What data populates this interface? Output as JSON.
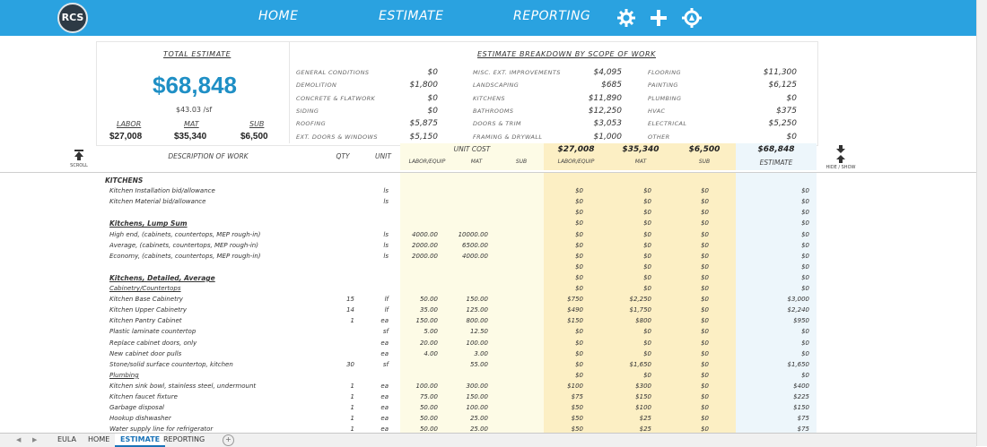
{
  "nav": {
    "logo": "RCS",
    "home": "HOME",
    "estimate": "ESTIMATE",
    "reporting": "REPORTING",
    "icons": [
      "gear-icon",
      "plus-icon",
      "settings-icon"
    ]
  },
  "summary": {
    "total_estimate_label": "TOTAL ESTIMATE",
    "total": "$68,848",
    "per_sf": "$43.03 /sf",
    "labor_label": "LABOR",
    "mat_label": "MAT",
    "sub_label": "SUB",
    "labor": "$27,008",
    "mat": "$35,340",
    "sub": "$6,500"
  },
  "breakdown": {
    "title": "ESTIMATE BREAKDOWN BY SCOPE OF WORK",
    "col1": [
      {
        "label": "GENERAL CONDITIONS",
        "value": "$0"
      },
      {
        "label": "DEMOLITION",
        "value": "$1,800"
      },
      {
        "label": "CONCRETE & FLATWORK",
        "value": "$0"
      },
      {
        "label": "SIDING",
        "value": "$0"
      },
      {
        "label": "ROOFING",
        "value": "$5,875"
      },
      {
        "label": "EXT. DOORS & WINDOWS",
        "value": "$5,150"
      }
    ],
    "col2": [
      {
        "label": "MISC. EXT. IMPROVEMENTS",
        "value": "$4,095"
      },
      {
        "label": "LANDSCAPING",
        "value": "$685"
      },
      {
        "label": "KITCHENS",
        "value": "$11,890"
      },
      {
        "label": "BATHROOMS",
        "value": "$12,250"
      },
      {
        "label": "DOORS & TRIM",
        "value": "$3,053"
      },
      {
        "label": "FRAMING & DRYWALL",
        "value": "$1,000"
      }
    ],
    "col3": [
      {
        "label": "FLOORING",
        "value": "$11,300"
      },
      {
        "label": "PAINTING",
        "value": "$6,125"
      },
      {
        "label": "PLUMBING",
        "value": "$0"
      },
      {
        "label": "HVAC",
        "value": "$375"
      },
      {
        "label": "ELECTRICAL",
        "value": "$5,250"
      },
      {
        "label": "OTHER",
        "value": "$0"
      }
    ]
  },
  "columns": {
    "scroll": "SCROLL",
    "hide_show": "HIDE / SHOW",
    "description": "DESCRIPTION OF WORK",
    "qty": "QTY",
    "unit": "UNIT",
    "unit_cost": "UNIT COST",
    "labor_equip": "LABOR/EQUIP",
    "mat": "MAT",
    "sub": "SUB",
    "tot_labor": "$27,008",
    "tot_mat": "$35,340",
    "tot_sub": "$6,500",
    "tot_estimate": "$68,848",
    "estimate": "ESTIMATE"
  },
  "rows": [
    {
      "desc": "KITCHENS",
      "type": "section",
      "qty": "",
      "unit": "",
      "ul": "",
      "um": "",
      "us": "",
      "l": "",
      "m": "",
      "s": "",
      "e": ""
    },
    {
      "desc": "Kitchen Installation bid/allowance",
      "type": "item",
      "qty": "",
      "unit": "ls",
      "ul": "",
      "um": "",
      "us": "",
      "l": "$0",
      "m": "$0",
      "s": "$0",
      "e": "$0"
    },
    {
      "desc": "Kitchen Material bid/allowance",
      "type": "item",
      "qty": "",
      "unit": "ls",
      "ul": "",
      "um": "",
      "us": "",
      "l": "$0",
      "m": "$0",
      "s": "$0",
      "e": "$0"
    },
    {
      "desc": "",
      "type": "item",
      "qty": "",
      "unit": "",
      "ul": "",
      "um": "",
      "us": "",
      "l": "$0",
      "m": "$0",
      "s": "$0",
      "e": "$0"
    },
    {
      "desc": "Kitchens, Lump Sum",
      "type": "subsection",
      "qty": "",
      "unit": "",
      "ul": "",
      "um": "",
      "us": "",
      "l": "$0",
      "m": "$0",
      "s": "$0",
      "e": "$0"
    },
    {
      "desc": "High end, (cabinets, countertops, MEP rough-in)",
      "type": "item",
      "qty": "",
      "unit": "ls",
      "ul": "4000.00",
      "um": "10000.00",
      "us": "",
      "l": "$0",
      "m": "$0",
      "s": "$0",
      "e": "$0"
    },
    {
      "desc": "Average, (cabinets, countertops, MEP rough-in)",
      "type": "item",
      "qty": "",
      "unit": "ls",
      "ul": "2000.00",
      "um": "6500.00",
      "us": "",
      "l": "$0",
      "m": "$0",
      "s": "$0",
      "e": "$0"
    },
    {
      "desc": "Economy, (cabinets, countertops, MEP rough-in)",
      "type": "item",
      "qty": "",
      "unit": "ls",
      "ul": "2000.00",
      "um": "4000.00",
      "us": "",
      "l": "$0",
      "m": "$0",
      "s": "$0",
      "e": "$0"
    },
    {
      "desc": "",
      "type": "item",
      "qty": "",
      "unit": "",
      "ul": "",
      "um": "",
      "us": "",
      "l": "$0",
      "m": "$0",
      "s": "$0",
      "e": "$0"
    },
    {
      "desc": "Kitchens, Detailed, Average",
      "type": "subsection",
      "qty": "",
      "unit": "",
      "ul": "",
      "um": "",
      "us": "",
      "l": "$0",
      "m": "$0",
      "s": "$0",
      "e": "$0"
    },
    {
      "desc": "Cabinetry/Countertops",
      "type": "group",
      "qty": "",
      "unit": "",
      "ul": "",
      "um": "",
      "us": "",
      "l": "$0",
      "m": "$0",
      "s": "$0",
      "e": "$0"
    },
    {
      "desc": "Kitchen Base Cabinetry",
      "type": "item",
      "qty": "15",
      "unit": "lf",
      "ul": "50.00",
      "um": "150.00",
      "us": "",
      "l": "$750",
      "m": "$2,250",
      "s": "$0",
      "e": "$3,000"
    },
    {
      "desc": "Kitchen Upper Cabinetry",
      "type": "item",
      "qty": "14",
      "unit": "lf",
      "ul": "35.00",
      "um": "125.00",
      "us": "",
      "l": "$490",
      "m": "$1,750",
      "s": "$0",
      "e": "$2,240"
    },
    {
      "desc": "Kitchen Pantry Cabinet",
      "type": "item",
      "qty": "1",
      "unit": "ea",
      "ul": "150.00",
      "um": "800.00",
      "us": "",
      "l": "$150",
      "m": "$800",
      "s": "$0",
      "e": "$950"
    },
    {
      "desc": "Plastic laminate countertop",
      "type": "item",
      "qty": "",
      "unit": "sf",
      "ul": "5.00",
      "um": "12.50",
      "us": "",
      "l": "$0",
      "m": "$0",
      "s": "$0",
      "e": "$0"
    },
    {
      "desc": "Replace cabinet doors, only",
      "type": "item",
      "qty": "",
      "unit": "ea",
      "ul": "20.00",
      "um": "100.00",
      "us": "",
      "l": "$0",
      "m": "$0",
      "s": "$0",
      "e": "$0"
    },
    {
      "desc": "New cabinet door pulls",
      "type": "item",
      "qty": "",
      "unit": "ea",
      "ul": "4.00",
      "um": "3.00",
      "us": "",
      "l": "$0",
      "m": "$0",
      "s": "$0",
      "e": "$0"
    },
    {
      "desc": "Stone/solid surface countertop, kitchen",
      "type": "item",
      "qty": "30",
      "unit": "sf",
      "ul": "",
      "um": "55.00",
      "us": "",
      "l": "$0",
      "m": "$1,650",
      "s": "$0",
      "e": "$1,650"
    },
    {
      "desc": "Plumbing",
      "type": "group",
      "qty": "",
      "unit": "",
      "ul": "",
      "um": "",
      "us": "",
      "l": "$0",
      "m": "$0",
      "s": "$0",
      "e": "$0"
    },
    {
      "desc": "Kitchen sink bowl, stainless steel, undermount",
      "type": "item",
      "qty": "1",
      "unit": "ea",
      "ul": "100.00",
      "um": "300.00",
      "us": "",
      "l": "$100",
      "m": "$300",
      "s": "$0",
      "e": "$400"
    },
    {
      "desc": "Kitchen faucet fixture",
      "type": "item",
      "qty": "1",
      "unit": "ea",
      "ul": "75.00",
      "um": "150.00",
      "us": "",
      "l": "$75",
      "m": "$150",
      "s": "$0",
      "e": "$225"
    },
    {
      "desc": "Garbage disposal",
      "type": "item",
      "qty": "1",
      "unit": "ea",
      "ul": "50.00",
      "um": "100.00",
      "us": "",
      "l": "$50",
      "m": "$100",
      "s": "$0",
      "e": "$150"
    },
    {
      "desc": "Hookup dishwasher",
      "type": "item",
      "qty": "1",
      "unit": "ea",
      "ul": "50.00",
      "um": "25.00",
      "us": "",
      "l": "$50",
      "m": "$25",
      "s": "$0",
      "e": "$75"
    },
    {
      "desc": "Water supply line for refrigerator",
      "type": "item",
      "qty": "1",
      "unit": "ea",
      "ul": "50.00",
      "um": "25.00",
      "us": "",
      "l": "$50",
      "m": "$25",
      "s": "$0",
      "e": "$75"
    }
  ],
  "tabs": [
    {
      "label": "EULA",
      "active": false
    },
    {
      "label": "HOME",
      "active": false
    },
    {
      "label": "ESTIMATE",
      "active": true
    },
    {
      "label": "REPORTING",
      "active": false
    }
  ],
  "colors": {
    "topbar": "#2aa2e0",
    "accent": "#1f8fc5",
    "cost_band": "#fdfbe6",
    "total_band": "#fcefc4",
    "estimate_band": "#edf6fb"
  }
}
